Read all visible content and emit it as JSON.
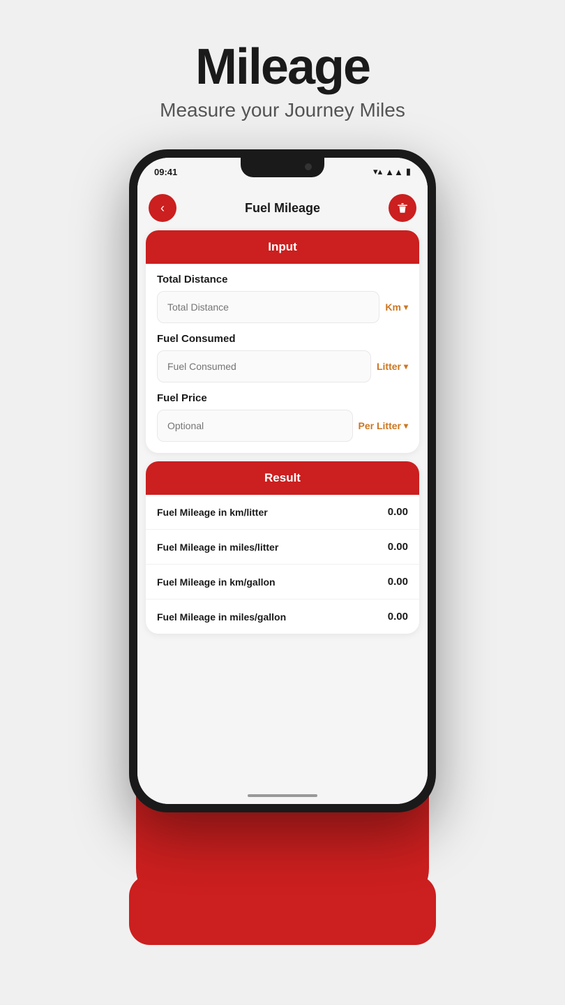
{
  "header": {
    "title": "Mileage",
    "subtitle": "Measure your Journey Miles"
  },
  "status_bar": {
    "time": "09:41"
  },
  "nav": {
    "title": "Fuel Mileage",
    "back_label": "‹",
    "trash_label": "🗑"
  },
  "input_section": {
    "header": "Input",
    "fields": [
      {
        "label": "Total Distance",
        "placeholder": "Total Distance",
        "unit": "Km",
        "unit_key": "total_distance_unit"
      },
      {
        "label": "Fuel Consumed",
        "placeholder": "Fuel Consumed",
        "unit": "Litter",
        "unit_key": "fuel_consumed_unit"
      },
      {
        "label": "Fuel Price",
        "placeholder": "Optional",
        "unit": "Per Litter",
        "unit_key": "fuel_price_unit"
      }
    ]
  },
  "result_section": {
    "header": "Result",
    "rows": [
      {
        "label": "Fuel Mileage in km/litter",
        "value": "0.00"
      },
      {
        "label": "Fuel Mileage in miles/litter",
        "value": "0.00"
      },
      {
        "label": "Fuel Mileage in km/gallon",
        "value": "0.00"
      },
      {
        "label": "Fuel Mileage in miles/gallon",
        "value": "0.00"
      }
    ]
  },
  "colors": {
    "accent": "#cc1f1f",
    "unit_color": "#cc7722"
  }
}
